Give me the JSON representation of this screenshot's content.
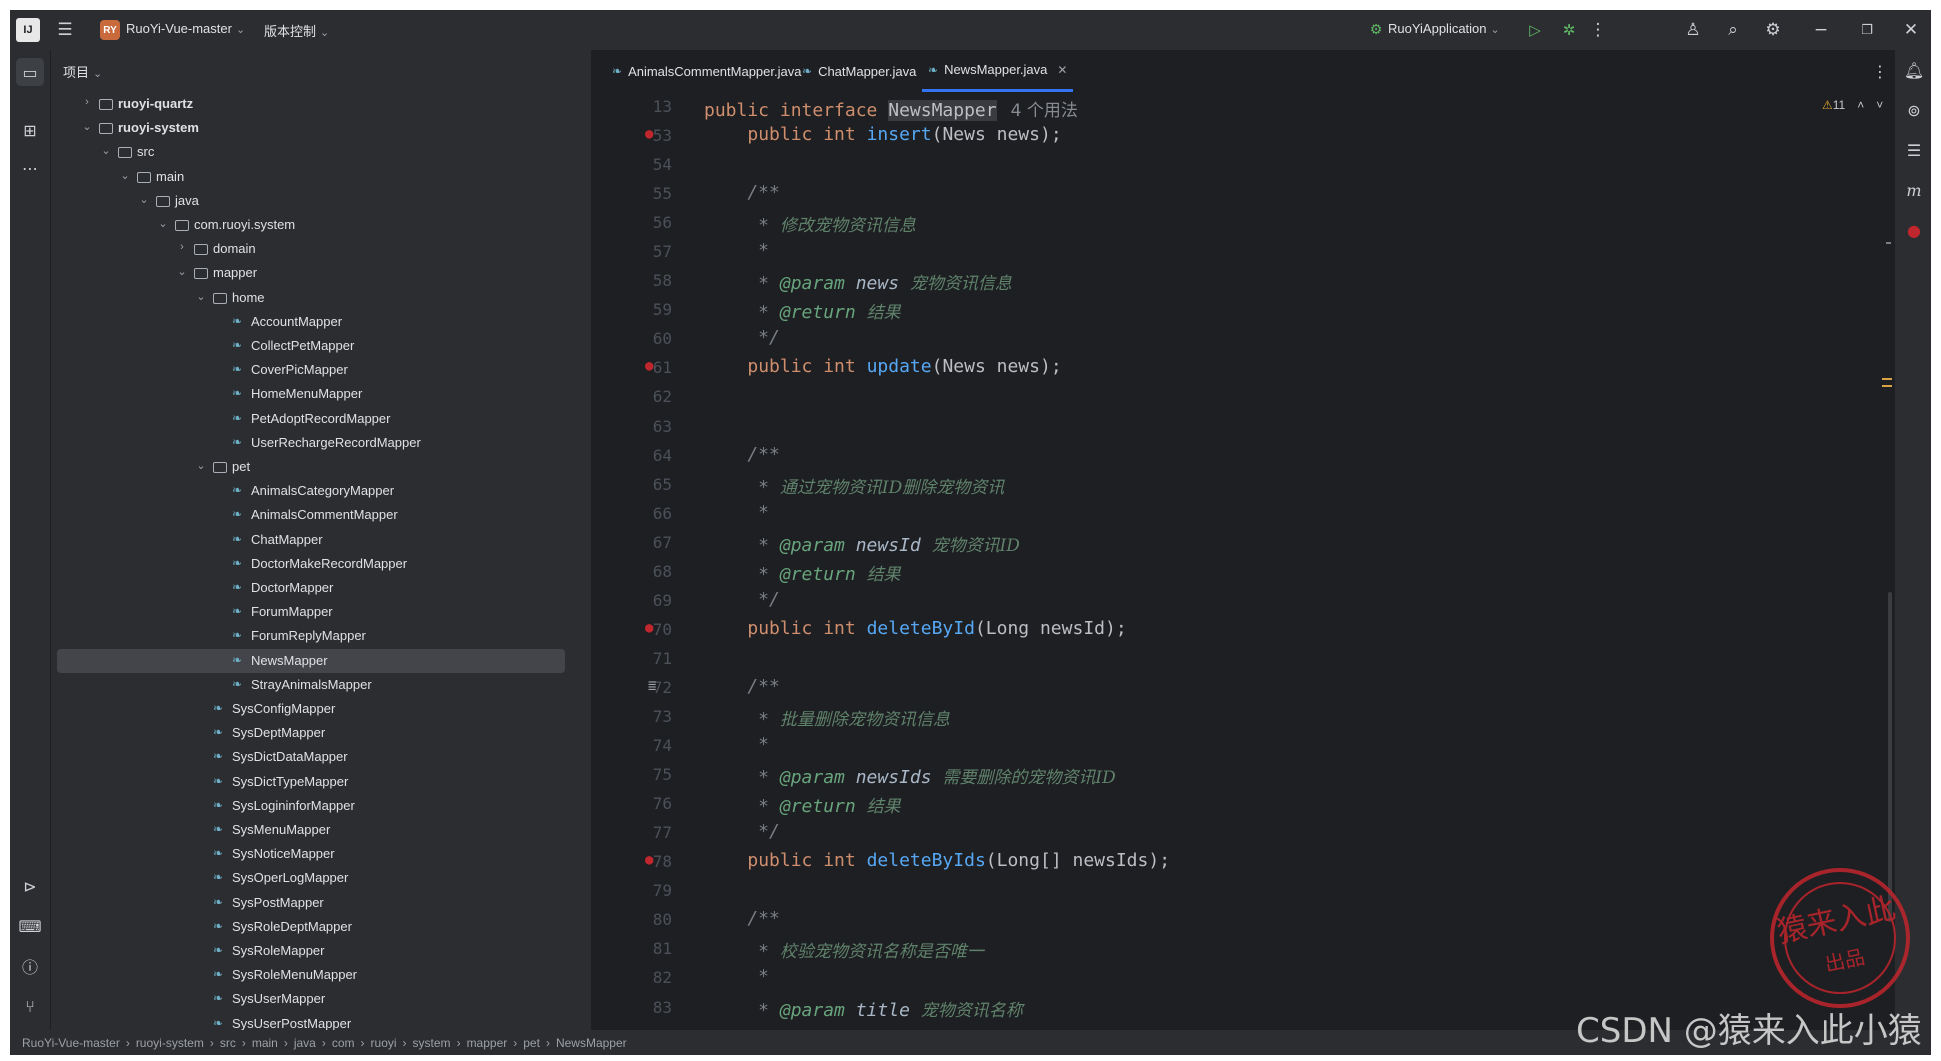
{
  "titlebar": {
    "project_badge": "RY",
    "project_name": "RuoYi-Vue-master",
    "vcs_label": "版本控制",
    "run_config": "RuoYiApplication"
  },
  "project_panel": {
    "title": "项目",
    "tree": [
      {
        "label": "ruoyi-quartz",
        "depth": 1,
        "arrow": "›",
        "type": "module",
        "bold": true
      },
      {
        "label": "ruoyi-system",
        "depth": 1,
        "arrow": "⌄",
        "type": "module",
        "bold": true
      },
      {
        "label": "src",
        "depth": 2,
        "arrow": "⌄",
        "type": "folder"
      },
      {
        "label": "main",
        "depth": 3,
        "arrow": "⌄",
        "type": "folder"
      },
      {
        "label": "java",
        "depth": 4,
        "arrow": "⌄",
        "type": "folder"
      },
      {
        "label": "com.ruoyi.system",
        "depth": 5,
        "arrow": "⌄",
        "type": "package"
      },
      {
        "label": "domain",
        "depth": 6,
        "arrow": "›",
        "type": "package"
      },
      {
        "label": "mapper",
        "depth": 6,
        "arrow": "⌄",
        "type": "package"
      },
      {
        "label": "home",
        "depth": 7,
        "arrow": "⌄",
        "type": "package"
      },
      {
        "label": "AccountMapper",
        "depth": 8,
        "type": "mapper"
      },
      {
        "label": "CollectPetMapper",
        "depth": 8,
        "type": "mapper"
      },
      {
        "label": "CoverPicMapper",
        "depth": 8,
        "type": "mapper"
      },
      {
        "label": "HomeMenuMapper",
        "depth": 8,
        "type": "mapper"
      },
      {
        "label": "PetAdoptRecordMapper",
        "depth": 8,
        "type": "mapper"
      },
      {
        "label": "UserRechargeRecordMapper",
        "depth": 8,
        "type": "mapper"
      },
      {
        "label": "pet",
        "depth": 7,
        "arrow": "⌄",
        "type": "package"
      },
      {
        "label": "AnimalsCategoryMapper",
        "depth": 8,
        "type": "mapper"
      },
      {
        "label": "AnimalsCommentMapper",
        "depth": 8,
        "type": "mapper"
      },
      {
        "label": "ChatMapper",
        "depth": 8,
        "type": "mapper"
      },
      {
        "label": "DoctorMakeRecordMapper",
        "depth": 8,
        "type": "mapper"
      },
      {
        "label": "DoctorMapper",
        "depth": 8,
        "type": "mapper"
      },
      {
        "label": "ForumMapper",
        "depth": 8,
        "type": "mapper"
      },
      {
        "label": "ForumReplyMapper",
        "depth": 8,
        "type": "mapper"
      },
      {
        "label": "NewsMapper",
        "depth": 8,
        "type": "mapper",
        "selected": true
      },
      {
        "label": "StrayAnimalsMapper",
        "depth": 8,
        "type": "mapper"
      },
      {
        "label": "SysConfigMapper",
        "depth": 7,
        "type": "mapper"
      },
      {
        "label": "SysDeptMapper",
        "depth": 7,
        "type": "mapper"
      },
      {
        "label": "SysDictDataMapper",
        "depth": 7,
        "type": "mapper"
      },
      {
        "label": "SysDictTypeMapper",
        "depth": 7,
        "type": "mapper"
      },
      {
        "label": "SysLogininforMapper",
        "depth": 7,
        "type": "mapper"
      },
      {
        "label": "SysMenuMapper",
        "depth": 7,
        "type": "mapper"
      },
      {
        "label": "SysNoticeMapper",
        "depth": 7,
        "type": "mapper"
      },
      {
        "label": "SysOperLogMapper",
        "depth": 7,
        "type": "mapper"
      },
      {
        "label": "SysPostMapper",
        "depth": 7,
        "type": "mapper"
      },
      {
        "label": "SysRoleDeptMapper",
        "depth": 7,
        "type": "mapper"
      },
      {
        "label": "SysRoleMapper",
        "depth": 7,
        "type": "mapper"
      },
      {
        "label": "SysRoleMenuMapper",
        "depth": 7,
        "type": "mapper"
      },
      {
        "label": "SysUserMapper",
        "depth": 7,
        "type": "mapper"
      },
      {
        "label": "SysUserPostMapper",
        "depth": 7,
        "type": "mapper"
      }
    ]
  },
  "editor": {
    "tabs": [
      {
        "label": "AnimalsCommentMapper.java",
        "active": false
      },
      {
        "label": "ChatMapper.java",
        "active": false
      },
      {
        "label": "NewsMapper.java",
        "active": true
      }
    ],
    "sticky": {
      "line": "13",
      "text_kw": "public interface ",
      "text_name": "NewsMapper",
      "usages": "4 个用法"
    },
    "warnings": "11",
    "lines": [
      {
        "n": "53",
        "parts": [
          [
            "",
            "    "
          ],
          [
            "kw",
            "public int "
          ],
          [
            "fn",
            "insert"
          ],
          [
            "",
            "(News news);"
          ]
        ],
        "gutter": "impl"
      },
      {
        "n": "54",
        "parts": []
      },
      {
        "n": "55",
        "parts": [
          [
            "cm",
            "    /**"
          ]
        ]
      },
      {
        "n": "56",
        "parts": [
          [
            "cm",
            "     * "
          ],
          [
            "cmz",
            "修改宠物资讯信息"
          ]
        ]
      },
      {
        "n": "57",
        "parts": [
          [
            "cm",
            "     *"
          ]
        ]
      },
      {
        "n": "58",
        "parts": [
          [
            "cm",
            "     * "
          ],
          [
            "tag",
            "@param "
          ],
          [
            "pv",
            "news "
          ],
          [
            "cmz",
            "宠物资讯信息"
          ]
        ]
      },
      {
        "n": "59",
        "parts": [
          [
            "cm",
            "     * "
          ],
          [
            "tag",
            "@return "
          ],
          [
            "cmz",
            "结果"
          ]
        ]
      },
      {
        "n": "60",
        "parts": [
          [
            "cm",
            "     */"
          ]
        ]
      },
      {
        "n": "61",
        "parts": [
          [
            "",
            "    "
          ],
          [
            "kw",
            "public int "
          ],
          [
            "fn",
            "update"
          ],
          [
            "",
            "(News news);"
          ]
        ],
        "gutter": "impl"
      },
      {
        "n": "62",
        "parts": []
      },
      {
        "n": "63",
        "parts": []
      },
      {
        "n": "64",
        "parts": [
          [
            "cm",
            "    /**"
          ]
        ]
      },
      {
        "n": "65",
        "parts": [
          [
            "cm",
            "     * "
          ],
          [
            "cmz",
            "通过宠物资讯ID删除宠物资讯"
          ]
        ]
      },
      {
        "n": "66",
        "parts": [
          [
            "cm",
            "     *"
          ]
        ]
      },
      {
        "n": "67",
        "parts": [
          [
            "cm",
            "     * "
          ],
          [
            "tag",
            "@param "
          ],
          [
            "pv",
            "newsId "
          ],
          [
            "cmz",
            "宠物资讯ID"
          ]
        ]
      },
      {
        "n": "68",
        "parts": [
          [
            "cm",
            "     * "
          ],
          [
            "tag",
            "@return "
          ],
          [
            "cmz",
            "结果"
          ]
        ]
      },
      {
        "n": "69",
        "parts": [
          [
            "cm",
            "     */"
          ]
        ]
      },
      {
        "n": "70",
        "parts": [
          [
            "",
            "    "
          ],
          [
            "kw",
            "public int "
          ],
          [
            "fn",
            "deleteById"
          ],
          [
            "",
            "(Long newsId);"
          ]
        ],
        "gutter": "impl"
      },
      {
        "n": "71",
        "parts": []
      },
      {
        "n": "72",
        "parts": [
          [
            "cm",
            "    /**"
          ]
        ],
        "gutter": "doc"
      },
      {
        "n": "73",
        "parts": [
          [
            "cm",
            "     * "
          ],
          [
            "cmz",
            "批量删除宠物资讯信息"
          ]
        ]
      },
      {
        "n": "74",
        "parts": [
          [
            "cm",
            "     *"
          ]
        ]
      },
      {
        "n": "75",
        "parts": [
          [
            "cm",
            "     * "
          ],
          [
            "tag",
            "@param "
          ],
          [
            "pv",
            "newsIds "
          ],
          [
            "cmz",
            "需要删除的宠物资讯ID"
          ]
        ]
      },
      {
        "n": "76",
        "parts": [
          [
            "cm",
            "     * "
          ],
          [
            "tag",
            "@return "
          ],
          [
            "cmz",
            "结果"
          ]
        ]
      },
      {
        "n": "77",
        "parts": [
          [
            "cm",
            "     */"
          ]
        ]
      },
      {
        "n": "78",
        "parts": [
          [
            "",
            "    "
          ],
          [
            "kw",
            "public int "
          ],
          [
            "fn",
            "deleteByIds"
          ],
          [
            "",
            "(Long[] newsIds);"
          ]
        ],
        "gutter": "impl"
      },
      {
        "n": "79",
        "parts": []
      },
      {
        "n": "80",
        "parts": [
          [
            "cm",
            "    /**"
          ]
        ]
      },
      {
        "n": "81",
        "parts": [
          [
            "cm",
            "     * "
          ],
          [
            "cmz",
            "校验宠物资讯名称是否唯一"
          ]
        ]
      },
      {
        "n": "82",
        "parts": [
          [
            "cm",
            "     *"
          ]
        ]
      },
      {
        "n": "83",
        "parts": [
          [
            "cm",
            "     * "
          ],
          [
            "tag",
            "@param "
          ],
          [
            "pv",
            "title "
          ],
          [
            "cmz",
            "宠物资讯名称"
          ]
        ]
      }
    ]
  },
  "breadcrumb": [
    "RuoYi-Vue-master",
    "ruoyi-system",
    "src",
    "main",
    "java",
    "com",
    "ruoyi",
    "system",
    "mapper",
    "pet",
    "NewsMapper"
  ],
  "watermark": "CSDN @猿来入此小猿",
  "colors": {
    "accent": "#3574f0",
    "keyword": "#cf8e6d",
    "function": "#56a8f5",
    "doc_comment": "#5f826b",
    "stamp": "#c0262d"
  }
}
